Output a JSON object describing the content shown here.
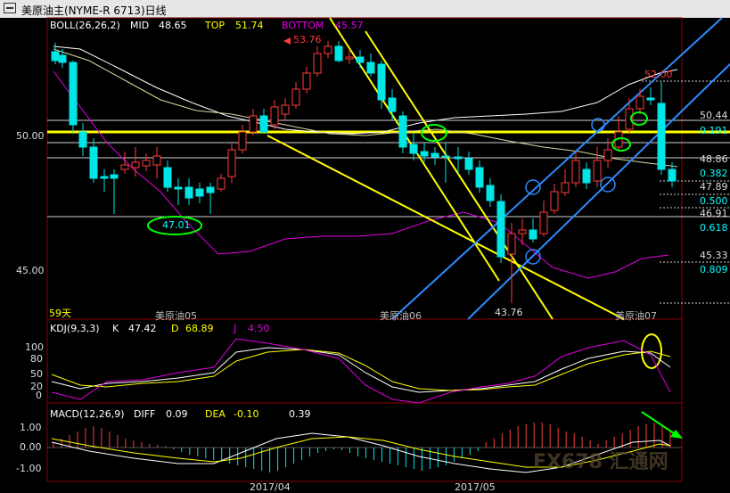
{
  "window": {
    "title": "美原油主(NYME-R 6713)日线"
  },
  "boll": {
    "name": "BOLL(26,26,2)",
    "mid_label": "MID",
    "mid_value": "48.65",
    "top_label": "TOP",
    "top_value": "51.74",
    "bottom_label": "BOTTOM",
    "bottom_value": "45.57"
  },
  "kdj": {
    "name": "KDJ(9,3,3)",
    "k_label": "K",
    "k_value": "47.42",
    "d_label": "D",
    "d_value": "68.89",
    "j_label": "J",
    "j_value": "4.50",
    "axis": [
      "100",
      "80",
      "50",
      "20",
      "0"
    ]
  },
  "macd": {
    "name": "MACD(12,26,9)",
    "diff_label": "DIFF",
    "diff_value": "0.09",
    "dea_label": "DEA",
    "dea_value": "-0.10",
    "macd_value": "0.39",
    "axis": [
      "1.00",
      "0.00",
      "-1.00"
    ]
  },
  "main": {
    "y_axis": [
      "50.00",
      "45.00"
    ],
    "annotations": {
      "high_label": "53.76",
      "low_label": "43.76",
      "support_label": "47.01",
      "peak_label": "52.00"
    },
    "fib_levels": [
      {
        "price": "50.44",
        "ratio": "0.191"
      },
      {
        "price": "48.86",
        "ratio": "0.382"
      },
      {
        "price": "47.89",
        "ratio": "0.500"
      },
      {
        "price": "46.91",
        "ratio": "0.618"
      },
      {
        "price": "45.33",
        "ratio": "0.809"
      }
    ],
    "days_label": "59天",
    "contract_labels": [
      "美原油05",
      "美原油06",
      "美原油07"
    ]
  },
  "x_axis": [
    "2017/04",
    "2017/05"
  ],
  "watermark": "FX678 汇通网",
  "colors": {
    "up": "#ff3b3b",
    "down": "#00e5e5",
    "yellow": "#ffff00",
    "magenta": "#e000e0",
    "blue": "#2b8cff",
    "green": "#00ff00"
  }
}
